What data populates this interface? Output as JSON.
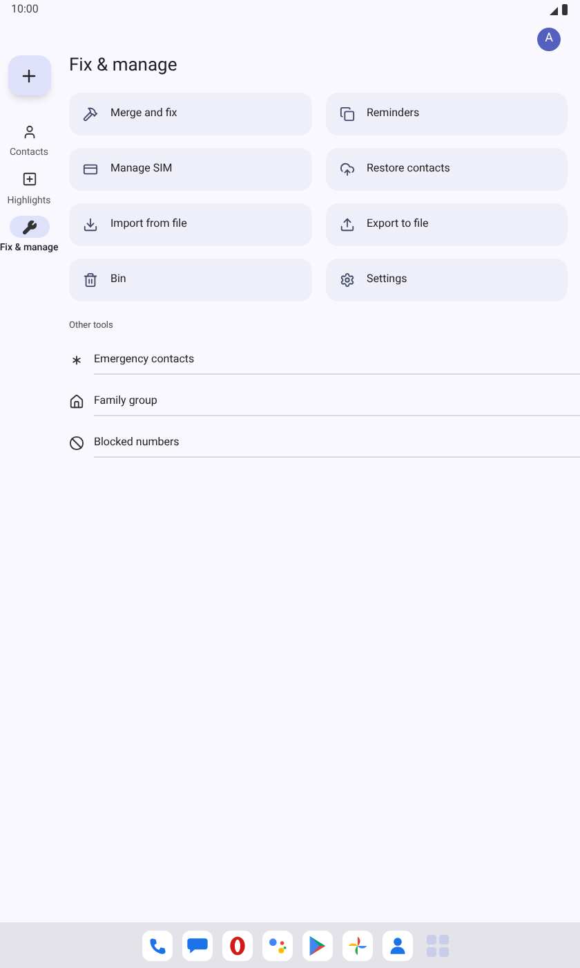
{
  "status_bar": {
    "time": "10:00"
  },
  "account": {
    "initial": "A"
  },
  "nav": [
    {
      "label": "Contacts",
      "selected": false
    },
    {
      "label": "Highlights",
      "selected": false
    },
    {
      "label": "Fix & manage",
      "selected": true
    }
  ],
  "title": "Fix & manage",
  "tiles": [
    {
      "label": "Merge and fix"
    },
    {
      "label": "Reminders"
    },
    {
      "label": "Manage SIM"
    },
    {
      "label": "Restore contacts"
    },
    {
      "label": "Import from file"
    },
    {
      "label": "Export to file"
    },
    {
      "label": "Bin"
    },
    {
      "label": "Settings"
    }
  ],
  "other_tools": {
    "heading": "Other tools",
    "items": [
      {
        "label": "Emergency contacts"
      },
      {
        "label": "Family group"
      },
      {
        "label": "Blocked numbers"
      }
    ]
  }
}
